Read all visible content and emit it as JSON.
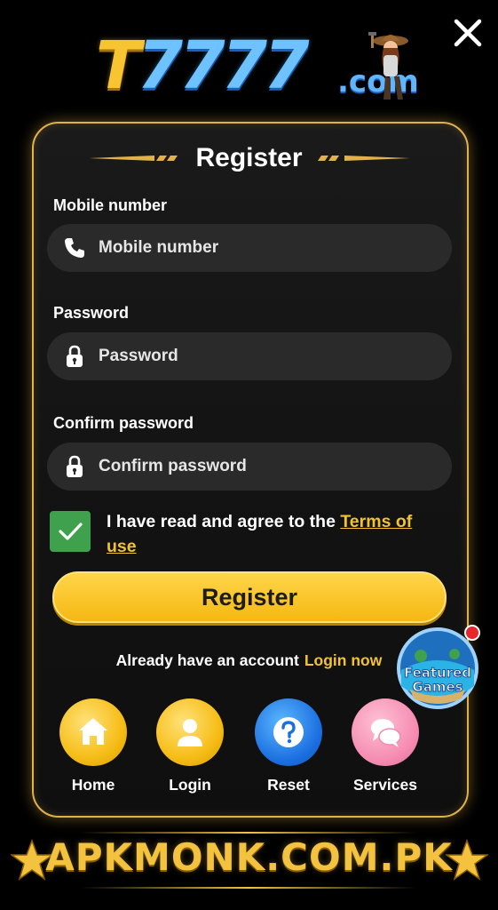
{
  "logo": {
    "brand_part1": "T",
    "brand_part2": "7777",
    "brand_suffix": ".com"
  },
  "form": {
    "title": "Register",
    "mobile": {
      "label": "Mobile number",
      "placeholder": "Mobile number",
      "value": ""
    },
    "password": {
      "label": "Password",
      "placeholder": "Password",
      "value": ""
    },
    "confirm_password": {
      "label": "Confirm password",
      "placeholder": "Confirm password",
      "value": ""
    },
    "agree_text": "I have read and agree to the ",
    "terms_link": "Terms of use",
    "agree_checked": true,
    "submit_label": "Register"
  },
  "account": {
    "question": "Already have an account",
    "login_link": "Login now"
  },
  "featured_badge": {
    "line1": "Featured",
    "line2": "Games"
  },
  "bottom_nav": [
    {
      "label": "Home",
      "icon": "home-icon",
      "color": "#f6bd17"
    },
    {
      "label": "Login",
      "icon": "user-icon",
      "color": "#f6bd17"
    },
    {
      "label": "Reset",
      "icon": "question-icon",
      "color": "#1b6fe0"
    },
    {
      "label": "Services",
      "icon": "chat-icon",
      "color": "#f58bb0"
    }
  ],
  "watermark": {
    "text": "APKMONK.COM.PK"
  },
  "colors": {
    "accent_gold": "#e2b24a",
    "button_yellow": "#f5b812",
    "link_yellow": "#f2c230",
    "checkbox_green": "#3fa14d"
  }
}
